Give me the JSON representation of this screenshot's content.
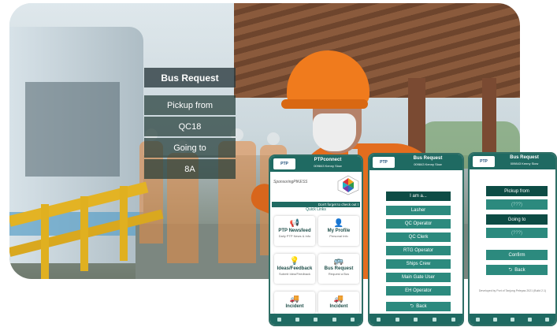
{
  "overlay": {
    "title": "Bus Request",
    "items": [
      "Pickup from",
      "QC18",
      "Going to",
      "8A"
    ]
  },
  "colors": {
    "brand_dark": "#0d4c45",
    "brand_header": "#1f6a62",
    "brand_button": "#2c8a7e",
    "accent_orange": "#e36d1e"
  },
  "phone1": {
    "logo": "PTP",
    "title": "PTPconnect",
    "subtitle": "009843 Kenny Siow",
    "sponsor": "SponsoringPIKESS",
    "marquee": "Don't forget to check out t",
    "quick_links": "Quick Links",
    "tiles": [
      {
        "icon": "megaphone-icon",
        "glyph": "📢",
        "label": "PTP Newsfeed",
        "sub": "Daily PTP News & Info"
      },
      {
        "icon": "person-icon",
        "glyph": "👤",
        "label": "My Profile",
        "sub": "Personal Info"
      },
      {
        "icon": "lightbulb-icon",
        "glyph": "💡",
        "label": "Ideas/Feedback",
        "sub": "Submit Idea/Feedback"
      },
      {
        "icon": "bus-icon",
        "glyph": "🚌",
        "label": "Bus Request",
        "sub": "Request a Bus"
      },
      {
        "icon": "truck-icon",
        "glyph": "🚚",
        "label": "Incident",
        "sub": ""
      },
      {
        "icon": "truck-icon",
        "glyph": "🚚",
        "label": "Incident",
        "sub": ""
      }
    ]
  },
  "phone2": {
    "logo": "PTP",
    "title": "Bus Request",
    "subtitle": "009843 Kenny Siow",
    "prompt": "I am a...",
    "roles": [
      "Lasher",
      "QC Operator",
      "QC Clerk",
      "RTG Operator",
      "Ships Crew",
      "Main Gate User",
      "EH Operator"
    ],
    "back": "Back"
  },
  "phone3": {
    "logo": "PTP",
    "title": "Bus Request",
    "subtitle": "009843 Kenny Siow",
    "pickup_label": "Pickup from",
    "pickup_value": "(???)",
    "going_label": "Going to",
    "going_value": "(???)",
    "confirm": "Confirm",
    "back": "Back",
    "developer": "Developed by Port of Tanjung Pelepas 2021 (Build 2.1)"
  }
}
